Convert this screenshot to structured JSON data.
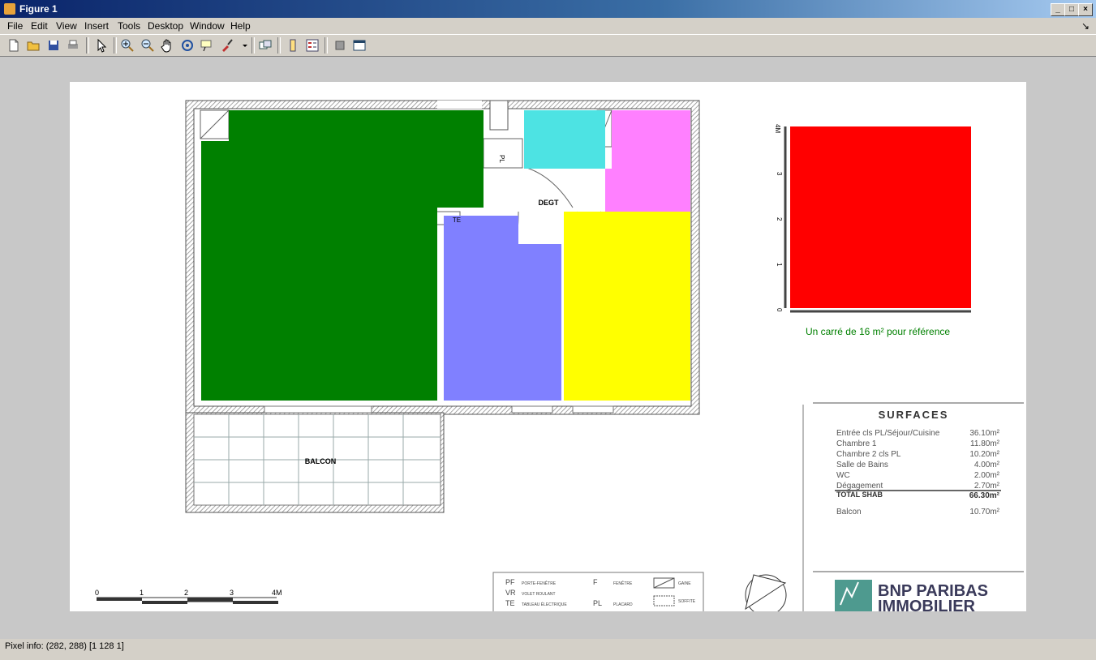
{
  "window": {
    "title": "Figure 1",
    "controls": [
      "_",
      "□",
      "×"
    ]
  },
  "menu": [
    "File",
    "Edit",
    "View",
    "Insert",
    "Tools",
    "Desktop",
    "Window",
    "Help"
  ],
  "menu_arrow": "↘",
  "toolbar_icons": [
    "new-figure-icon",
    "open-file-icon",
    "save-icon",
    "print-icon",
    "pointer-icon",
    "zoom-in-icon",
    "zoom-out-icon",
    "pan-icon",
    "rotate-3d-icon",
    "data-cursor-icon",
    "brush-icon",
    "link-icon",
    "colorbar-icon",
    "legend-icon",
    "hide-plot-tools-icon",
    "show-plot-tools-icon"
  ],
  "plan": {
    "labels": {
      "degt": "DEGT",
      "pl": "PL",
      "te": "TE",
      "balcon": "BALCON"
    },
    "rooms": [
      {
        "name": "sejour",
        "color": "#008000"
      },
      {
        "name": "salle-de-bains",
        "color": "#4de3e3"
      },
      {
        "name": "wc",
        "color": "#ff80ff"
      },
      {
        "name": "chambre-1",
        "color": "#8080ff"
      },
      {
        "name": "chambre-2",
        "color": "#ffff00"
      }
    ]
  },
  "reference": {
    "caption": "Un carré de 16 m² pour référence",
    "color": "#ff0000",
    "ticks": [
      "0",
      "1",
      "2",
      "3",
      "4M"
    ]
  },
  "scale_bar": [
    "0",
    "1",
    "2",
    "3",
    "4M"
  ],
  "surfaces": {
    "title": "SURFACES",
    "rows": [
      {
        "label": "Entrée cls PL/Séjour/Cuisine",
        "value": "36.10m²"
      },
      {
        "label": "Chambre 1",
        "value": "11.80m²"
      },
      {
        "label": "Chambre 2 cls PL",
        "value": "10.20m²"
      },
      {
        "label": "Salle de Bains",
        "value": "4.00m²"
      },
      {
        "label": "WC",
        "value": "2.00m²"
      },
      {
        "label": "Dégagement",
        "value": "2.70m²"
      }
    ],
    "total": {
      "label": "TOTAL SHAB",
      "value": "66.30m²"
    },
    "balcon": {
      "label": "Balcon",
      "value": "10.70m²"
    }
  },
  "legend": [
    {
      "code": "PF",
      "text": "PORTE-FENÊTRE"
    },
    {
      "code": "VR",
      "text": "VOLET ROULANT"
    },
    {
      "code": "TE",
      "text": "TABLEAU ÉLECTRIQUE"
    },
    {
      "code": "F",
      "text": "FENÊTRE"
    },
    {
      "code": "PL",
      "text": "PLACARD"
    },
    {
      "code": "",
      "text": "GAINE"
    },
    {
      "code": "",
      "text": "SOFFITE"
    }
  ],
  "logo": {
    "line1": "BNP PARIBAS",
    "line2": "IMMOBILIER"
  },
  "status": "Pixel info: (282, 288)  [1 128 1]"
}
